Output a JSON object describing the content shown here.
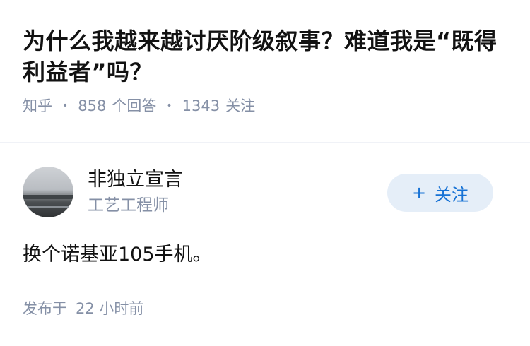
{
  "question": {
    "title": "为什么我越来越讨厌阶级叙事？难道我是“既得利益者”吗？",
    "source": "知乎",
    "answer_count": "858",
    "answer_label": "个回答",
    "follow_count": "1343",
    "follow_label": "关注"
  },
  "author": {
    "name": "非独立宣言",
    "headline": "工艺工程师",
    "follow_plus": "+",
    "follow_label": "关注"
  },
  "answer": {
    "content": "换个诺基亚105手机。",
    "time_label": "发布于",
    "time_value": "22 小时前"
  },
  "colors": {
    "text_primary": "#121212",
    "text_secondary": "#8590a6",
    "accent": "#1772d5",
    "button_bg": "#e5eef8"
  }
}
